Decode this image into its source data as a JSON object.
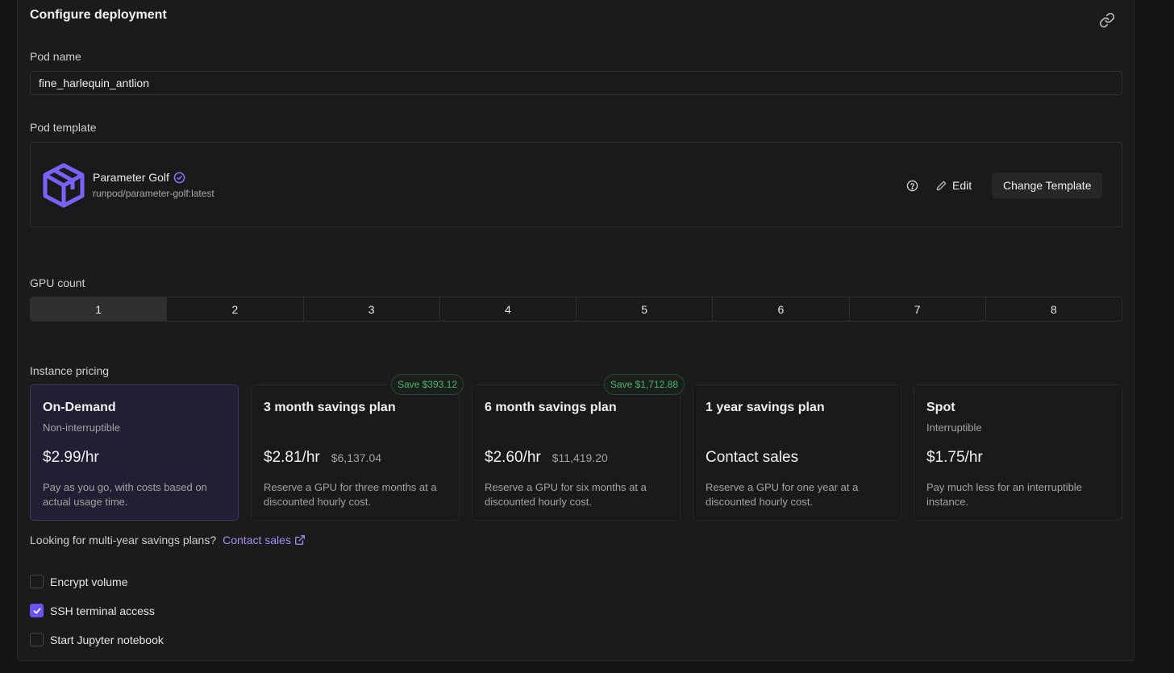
{
  "header": {
    "title": "Configure deployment",
    "link_icon": "link-icon"
  },
  "pod_name": {
    "label": "Pod name",
    "value": "fine_harlequin_antlion"
  },
  "pod_template": {
    "label": "Pod template",
    "name": "Parameter Golf",
    "image": "runpod/parameter-golf:latest",
    "verified_icon": "verified-check-icon",
    "help_icon": "help-circle-icon",
    "edit_label": "Edit",
    "change_label": "Change Template",
    "accent_color": "#7b61ff"
  },
  "gpu_count": {
    "label": "GPU count",
    "options": [
      "1",
      "2",
      "3",
      "4",
      "5",
      "6",
      "7",
      "8"
    ],
    "selected": "1"
  },
  "pricing": {
    "label": "Instance pricing",
    "plans": [
      {
        "title": "On-Demand",
        "subtitle": "Non-interruptible",
        "price": "$2.99/hr",
        "total": "",
        "badge": "",
        "description": "Pay as you go, with costs based on actual usage time.",
        "selected": true
      },
      {
        "title": "3 month savings plan",
        "subtitle": "",
        "price": "$2.81/hr",
        "total": "$6,137.04",
        "badge": "Save $393.12",
        "description": "Reserve a GPU for three months at a discounted hourly cost.",
        "selected": false
      },
      {
        "title": "6 month savings plan",
        "subtitle": "",
        "price": "$2.60/hr",
        "total": "$11,419.20",
        "badge": "Save $1,712.88",
        "description": "Reserve a GPU for six months at a discounted hourly cost.",
        "selected": false
      },
      {
        "title": "1 year savings plan",
        "subtitle": "",
        "price": "Contact sales",
        "total": "",
        "badge": "",
        "description": "Reserve a GPU for one year at a discounted hourly cost.",
        "selected": false
      },
      {
        "title": "Spot",
        "subtitle": "Interruptible",
        "price": "$1.75/hr",
        "total": "",
        "badge": "",
        "description": "Pay much less for an interruptible instance.",
        "selected": false
      }
    ]
  },
  "multi_year": {
    "text": "Looking for multi-year savings plans?",
    "link": "Contact sales"
  },
  "options": {
    "encrypt_volume": {
      "label": "Encrypt volume",
      "checked": false
    },
    "ssh_access": {
      "label": "SSH terminal access",
      "checked": true
    },
    "jupyter": {
      "label": "Start Jupyter notebook",
      "checked": false
    }
  },
  "colors": {
    "accent": "#6d52f5",
    "link": "#a58cf7",
    "savings_green": "#46b86a"
  }
}
